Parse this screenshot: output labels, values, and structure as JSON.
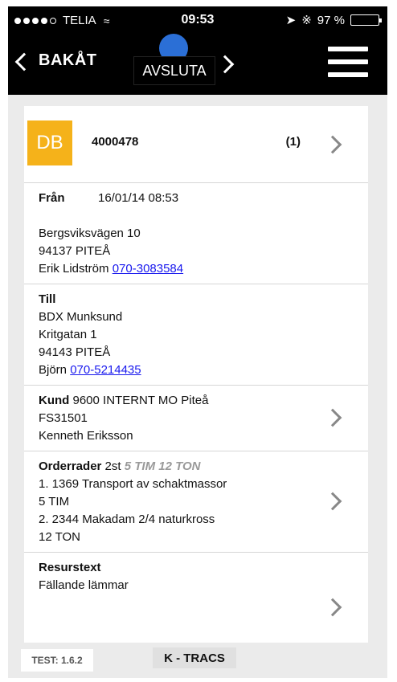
{
  "status_bar": {
    "carrier": "TELIA",
    "time": "09:53",
    "battery": "97 %",
    "battery_level": 0.97,
    "battery_color": "#3ccc4a"
  },
  "nav": {
    "back_label": "BAKÅT",
    "action_label": "AVSLUTA"
  },
  "order": {
    "badge": "DB",
    "badge_color": "#f5b21a",
    "number": "4000478",
    "count": "(1)"
  },
  "from": {
    "label": "Från",
    "datetime": "16/01/14 08:53",
    "street": "Bergsviksvägen 10",
    "city": "94137 PITEÅ",
    "contact": "Erik Lidström",
    "phone": "070-3083584"
  },
  "to": {
    "label": "Till",
    "name": "BDX Munksund",
    "street": "Kritgatan 1",
    "city": "94143 PITEÅ",
    "contact": "Björn",
    "phone": "070-5214435"
  },
  "customer": {
    "label": "Kund",
    "name": "9600 INTERNT MO Piteå",
    "code": "FS31501",
    "person": "Kenneth Eriksson"
  },
  "order_rows": {
    "label": "Orderrader",
    "count": "2st",
    "summary": "5 TIM 12 TON",
    "lines": [
      "1. 1369 Transport av schaktmassor",
      "5 TIM",
      "2. 2344 Makadam 2/4 naturkross",
      "12 TON"
    ]
  },
  "resource": {
    "label": "Resurstext",
    "text": "Fällande lämmar"
  },
  "footer": {
    "version": "TEST: 1.6.2",
    "brand": "K - TRACS"
  }
}
